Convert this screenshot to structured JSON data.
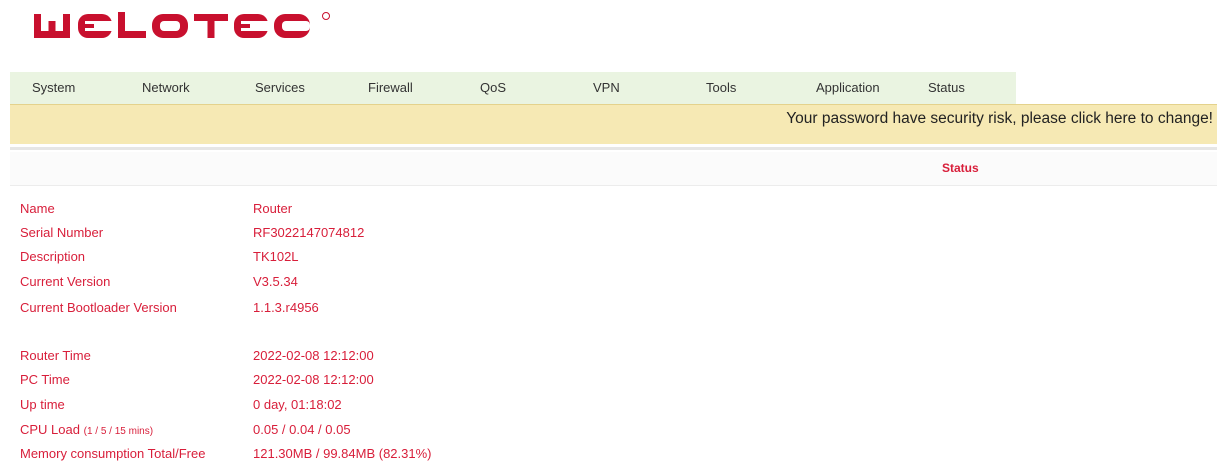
{
  "brand": {
    "logo_text": "WELOTEC",
    "logo_color": "#c8102e"
  },
  "nav": {
    "items": [
      {
        "label": "System"
      },
      {
        "label": "Network"
      },
      {
        "label": "Services"
      },
      {
        "label": "Firewall"
      },
      {
        "label": "QoS"
      },
      {
        "label": "VPN"
      },
      {
        "label": "Tools"
      },
      {
        "label": "Application"
      },
      {
        "label": "Status"
      }
    ]
  },
  "warning": {
    "text": "Your password have security risk, please click here to change!"
  },
  "status": {
    "title": "Status"
  },
  "device_info": [
    {
      "label": "Name",
      "value": "Router"
    },
    {
      "label": "Serial Number",
      "value": "RF3022147074812"
    },
    {
      "label": "Description",
      "value": "TK102L"
    },
    {
      "label": "Current Version",
      "value": "V3.5.34"
    },
    {
      "label": "Current Bootloader Version",
      "value": "1.1.3.r4956"
    }
  ],
  "runtime_info": [
    {
      "label": "Router Time",
      "label_suffix": "",
      "value": "2022-02-08 12:12:00"
    },
    {
      "label": "PC Time",
      "label_suffix": "",
      "value": "2022-02-08 12:12:00"
    },
    {
      "label": "Up time",
      "label_suffix": "",
      "value": "0 day, 01:18:02"
    },
    {
      "label": "CPU Load",
      "label_suffix": "(1 / 5 / 15 mins)",
      "value": "0.05 / 0.04 / 0.05"
    },
    {
      "label": "Memory consumption Total/Free",
      "label_suffix": "",
      "value": "121.30MB / 99.84MB (82.31%)"
    }
  ],
  "colors": {
    "accent_red": "#d81e3a",
    "nav_bg": "#eaf4e1",
    "warning_bg": "#f6e9b4"
  }
}
